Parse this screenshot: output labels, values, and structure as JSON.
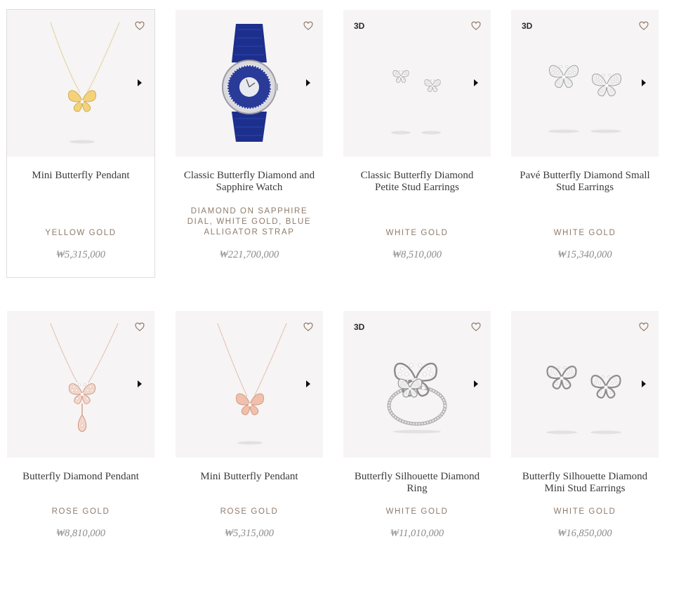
{
  "products": [
    {
      "name": "Mini Butterfly Pendant",
      "sub": "YELLOW GOLD",
      "price": "₩5,315,000",
      "badge": "",
      "selected": true,
      "art": "pendant-yellow"
    },
    {
      "name": "Classic Butterfly Diamond and Sapphire Watch",
      "sub": "DIAMOND ON SAPPHIRE DIAL, WHITE GOLD, BLUE ALLIGATOR STRAP",
      "price": "₩221,700,000",
      "badge": "",
      "selected": false,
      "art": "watch"
    },
    {
      "name": "Classic Butterfly Diamond Petite Stud Earrings",
      "sub": "WHITE GOLD",
      "price": "₩8,510,000",
      "badge": "3D",
      "selected": false,
      "art": "studs-small"
    },
    {
      "name": "Pavé Butterfly Diamond Small Stud Earrings",
      "sub": "WHITE GOLD",
      "price": "₩15,340,000",
      "badge": "3D",
      "selected": false,
      "art": "studs-pave"
    },
    {
      "name": "Butterfly Diamond Pendant",
      "sub": "ROSE GOLD",
      "price": "₩8,810,000",
      "badge": "",
      "selected": false,
      "art": "pendant-drop"
    },
    {
      "name": "Mini Butterfly Pendant",
      "sub": "ROSE GOLD",
      "price": "₩5,315,000",
      "badge": "",
      "selected": false,
      "art": "pendant-rose"
    },
    {
      "name": "Butterfly Silhouette Diamond Ring",
      "sub": "WHITE GOLD",
      "price": "₩11,010,000",
      "badge": "3D",
      "selected": false,
      "art": "ring"
    },
    {
      "name": "Butterfly Silhouette Diamond Mini Stud Earrings",
      "sub": "WHITE GOLD",
      "price": "₩16,850,000",
      "badge": "",
      "selected": false,
      "art": "studs-outline"
    }
  ],
  "icons": {
    "wishlist": "heart-icon",
    "next": "play-triangle-icon"
  },
  "colors": {
    "card_bg": "#f6f4f4",
    "subtitle": "#8e7b6c",
    "price": "#8c8c8c"
  }
}
